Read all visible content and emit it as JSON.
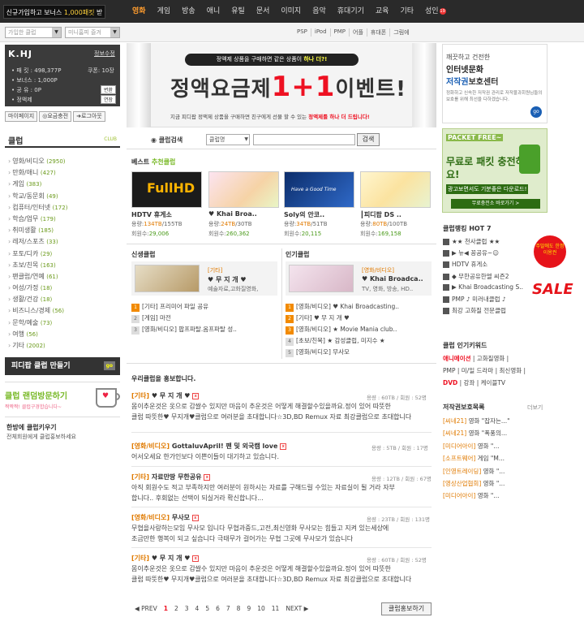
{
  "top": {
    "promo_text": "신규가입하고 보너스 ",
    "promo_highlight": "1,000패킷",
    "promo_tail": " 받자!",
    "nav": [
      "영화",
      "게임",
      "방송",
      "애니",
      "유틸",
      "문서",
      "이미지",
      "음악",
      "휴대기기",
      "교육",
      "기타",
      "성인"
    ],
    "adult_badge": "19"
  },
  "sub": {
    "select1": "가입한 클럽",
    "select2": "미니홈피 즐겨",
    "links": [
      "PSP",
      "iPod",
      "PMP",
      "어플",
      "휴대폰",
      "그림에"
    ]
  },
  "user": {
    "logo": "K.HJ",
    "edit": "정보수정",
    "packet_label": "• 패 킷 : 498,377P",
    "coupon": "쿠폰: 10장",
    "bonus": "• 보너스 : 1,000P",
    "share_label": "• 공 유 : 0P",
    "share_btn": "변환",
    "fixed_label": "• 정액제",
    "fixed_btn": "연장",
    "buttons": [
      "마이페이지",
      "요금충전",
      "로그아웃"
    ]
  },
  "club": {
    "title": "클럽",
    "subtitle": "CLUB",
    "categories": [
      {
        "name": "영화/비디오",
        "count": "(2950)"
      },
      {
        "name": "만화/애니",
        "count": "(427)"
      },
      {
        "name": "게임",
        "count": "(383)"
      },
      {
        "name": "학교/동문회",
        "count": "(49)"
      },
      {
        "name": "컴퓨터/인터넷",
        "count": "(172)"
      },
      {
        "name": "학습/업무",
        "count": "(179)"
      },
      {
        "name": "취미생활",
        "count": "(185)"
      },
      {
        "name": "레저/스포츠",
        "count": "(33)"
      },
      {
        "name": "포토/디카",
        "count": "(29)"
      },
      {
        "name": "초보/친목",
        "count": "(163)"
      },
      {
        "name": "팬클럽/연예",
        "count": "(61)"
      },
      {
        "name": "여성/가정",
        "count": "(18)"
      },
      {
        "name": "생활/건강",
        "count": "(18)"
      },
      {
        "name": "비즈니스/경제",
        "count": "(56)"
      },
      {
        "name": "문학/예술",
        "count": "(73)"
      },
      {
        "name": "여행",
        "count": "(56)"
      },
      {
        "name": "기타",
        "count": "(2002)"
      }
    ],
    "make_btn": "피디팝 클럽 만들기",
    "make_go": "go",
    "random_title": "클럽 랜덤방문하기",
    "random_sub": "짝짝짝! 클럽구경합습니다~",
    "hanbang_title": "한방에 클럽키우기",
    "hanbang_sub": "전체회원에게 클럽홍보하세요"
  },
  "banner": {
    "top_pre": "정액제 상품을 구매하면 같은 상품이 ",
    "top_hl": "하나 더?!",
    "main_pre": "정액요금제",
    "main_hl": "1+1",
    "main_post": "이벤트!",
    "sub_pre": "지금 피디팝 정액제 상품을 구매하면 친구에게 선물 할 수 있는 ",
    "sub_hl": "정액제를 하나 더 드립니다!"
  },
  "search": {
    "label": "클럽검색",
    "select": "클럽명",
    "button": "검색"
  },
  "best": {
    "title_pre": "베스트 ",
    "title_hl": "추천클럽",
    "items": [
      {
        "title": "HDTV 휴게소",
        "cap": "용량:",
        "cap_val": "134TB",
        "cap_tot": "/155TB",
        "mem": "회원수:",
        "mem_val": "29,006",
        "img": "FullHD"
      },
      {
        "title": "♥ Khai Broa..",
        "cap": "용량:",
        "cap_val": "24TB",
        "cap_tot": "/30TB",
        "mem": "회원수:",
        "mem_val": "260,362",
        "img": ""
      },
      {
        "title": "Soly의 안코..",
        "cap": "용량:",
        "cap_val": "34TB",
        "cap_tot": "/51TB",
        "mem": "회원수:",
        "mem_val": "20,115",
        "img": "Have a Good Time"
      },
      {
        "title": "┃피디팝 DS ..",
        "cap": "용량:",
        "cap_val": "80TB",
        "cap_tot": "/100TB",
        "mem": "회원수:",
        "mem_val": "169,158",
        "img": ""
      }
    ]
  },
  "newclub": {
    "title": "신생클럽",
    "feat_cat": "[기타]",
    "feat_title": "♥ 무 지 개 ♥",
    "feat_desc": "예술자료,고화질영화,",
    "list": [
      "[기타] 프리미어 파일 공유",
      "[게임] 마전",
      "[영화/비디오] 팝프파탈.옴프파탈 성.."
    ]
  },
  "popclub": {
    "title": "인기클럽",
    "feat_cat": "[영화/비디오]",
    "feat_title": "♥ Khai Broadca..",
    "feat_desc": "TV, 영화, 방송, HD..",
    "list": [
      "[영화/비디오] ♥ Khai Broadcasting..",
      "[기타] ♥ 무 지 개 ♥",
      "[영화/비디오] ★ Movie Mania club..",
      "[초보/친목] ★ 감성클럽, 미지수 ★",
      "[영화/비디오] 무사모"
    ]
  },
  "promo": {
    "title": "우리클럽을 홍보합니다.",
    "entries": [
      {
        "cat": "[기타]",
        "name": "♥ 무 지 개 ♥",
        "meta": "용량 : 60TB / 회원 : 52명",
        "l1": "몸이추운것은 옷으로 감쌀수 있지만 마음이 추운것은 어떻게 해결할수있을까요.정이 있어 따뜻한",
        "l2": "클럽 따뜻한♥ 무지개♥클럽으로 여러분을 초대합니다☆3D,BD Remux 자료 최강클럽으로 초대합니다"
      },
      {
        "cat": "[영화/비디오]",
        "name": "GottaluvApril! 팬 및 외국캠 love",
        "meta": "용량 : 5TB / 회원 : 17명",
        "l1": "어서오세요 한가인보다 이쁜이들이 대기하고 있습니다.",
        "l2": ""
      },
      {
        "cat": "[기타]",
        "name": "자료만땅 무한공유",
        "meta": "용량 : 12TB / 회원 : 67명",
        "l1": "아직 회원수도 적고 부족하지만 여러분이 원하시는 자료를 구해드릴 수있는 자료실이 될 거라 자부",
        "l2": "합니다.. 후회없는 선택이 되실거라 확신합니다..."
      },
      {
        "cat": "[영화/비디오]",
        "name": "무사모",
        "meta": "용량 : 23TB / 회원 : 131명",
        "l1": "무협을사랑하는모임 무사모 입니다 무협과중드,고전,최신영화 무사모는 힘들고 지켜 있는세상에",
        "l2": "조금만한 행복이 되고 싶습니다 극태무가 걸어가는 무협 그곳에 무사모가 있습니다"
      },
      {
        "cat": "[기타]",
        "name": "♥ 무 지 개 ♥",
        "meta": "용량 : 60TB / 회원 : 52명",
        "l1": "몸이추운것은 옷으로 감쌀수 있지만 마음이 추운것은 어떻게 해결할수있을까요.정이 있어 따뜻한",
        "l2": "클럽 따뜻한♥ 무지개♥클럽으로 여러분을 초대합니다☆3D,BD Remux 자료 최강클럽으로 초대합니다"
      }
    ],
    "pager": {
      "prev": "◀ PREV",
      "pages": [
        "1",
        "2",
        "3",
        "4",
        "5",
        "6",
        "7",
        "8",
        "9",
        "10",
        "11"
      ],
      "next": "NEXT ▶"
    },
    "button": "클럽홍보하기"
  },
  "right": {
    "ad1": {
      "a": "깨끗하고 건전한",
      "b": "인터넷문화",
      "c_hl": "저작권",
      "c_post": "보호센터",
      "d": "정화하고 신속한 저작권 관리로 저작물과회원님들의 보호를 위해 최선을 다하겠습니다.",
      "go": "go"
    },
    "ad2": {
      "a": "PACKET FREE~",
      "b": "무료로 패킷 충전하세요!",
      "c": "광고보면서도 기분좋은 다운로드!",
      "d": "무료충전소 바로가기 >"
    },
    "rank_title": "클럽랭킹 HOT 7",
    "ranks": [
      "★★ 천사클럽 ★★",
      "▶ 뉴◀ 꽁공유~☺",
      "HDTV 휴게소",
      "◆ 무한공유한엘 씨즌2",
      "▶ Khai Broadcasting S..",
      "PMP ♪ 미러내클럽 ♪",
      "최강 고화질 전문클럽"
    ],
    "sale_badge": "주말에도 한정 이용권",
    "sale_text": "SALE",
    "kw_title": "클럽 인기키워드",
    "kw1": "애니메이션",
    "kw_line1": " | 고화질영화 |",
    "kw_line2": "PMP | 미/일 드라마 | 최신영화 |",
    "kw3": "DVD",
    "kw_line3": " | 강좌 | 케이블TV",
    "copy_title": "저작권보호목록",
    "copy_more": "더보기",
    "copy_list": [
      {
        "cat": "[씨네21]",
        "title": " 영화 \"잡자는...\""
      },
      {
        "cat": "[씨네21]",
        "title": " 영화 \"폭풍의..."
      },
      {
        "cat": "[미디어아이]",
        "title": " 영화 \"..."
      },
      {
        "cat": "[소프트웨어]",
        "title": " 게임 \"M..."
      },
      {
        "cat": "[인영트레이딩]",
        "title": " 영화 \"..."
      },
      {
        "cat": "[영상산업협회]",
        "title": " 영화 \"..."
      },
      {
        "cat": "[미디어아이]",
        "title": " 영화 \"..."
      }
    ]
  }
}
